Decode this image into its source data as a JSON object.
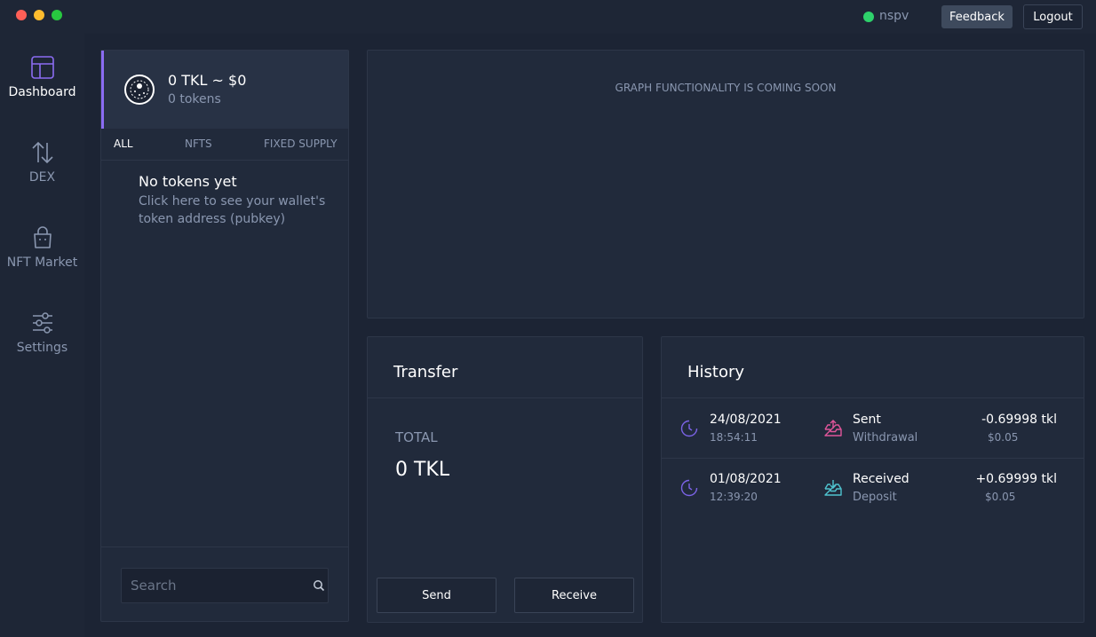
{
  "window": {
    "controls": [
      "close",
      "minimize",
      "maximize"
    ]
  },
  "header": {
    "status_label": "nspv",
    "status_color": "#2ed16b",
    "feedback_label": "Feedback",
    "logout_label": "Logout"
  },
  "nav": {
    "items": [
      {
        "label": "Dashboard",
        "icon": "dashboard-icon",
        "active": true
      },
      {
        "label": "DEX",
        "icon": "swap-arrows-icon",
        "active": false
      },
      {
        "label": "NFT Market",
        "icon": "shopping-bag-icon",
        "active": false
      },
      {
        "label": "Settings",
        "icon": "sliders-icon",
        "active": false
      }
    ]
  },
  "tokens": {
    "summary_value": "0 TKL ~ $0",
    "summary_count": "0 tokens",
    "tabs": [
      "ALL",
      "NFTS",
      "FIXED SUPPLY"
    ],
    "active_tab": "ALL",
    "empty_title": "No tokens yet",
    "empty_desc": "Click here to see your wallet's token address (pubkey)",
    "search_placeholder": "Search"
  },
  "graph": {
    "message": "GRAPH FUNCTIONALITY IS COMING SOON"
  },
  "transfer": {
    "title": "Transfer",
    "total_label": "TOTAL",
    "total_value": "0 TKL",
    "send_label": "Send",
    "receive_label": "Receive"
  },
  "history": {
    "title": "History",
    "rows": [
      {
        "date": "24/08/2021",
        "time": "18:54:11",
        "type": "Sent",
        "subtype": "Withdrawal",
        "amount": "-0.69998 tkl",
        "usd": "$0.05",
        "icon": "outbox-icon",
        "icon_color": "#e0559a"
      },
      {
        "date": "01/08/2021",
        "time": "12:39:20",
        "type": "Received",
        "subtype": "Deposit",
        "amount": "+0.69999 tkl",
        "usd": "$0.05",
        "icon": "inbox-icon",
        "icon_color": "#4fc3cf"
      }
    ]
  },
  "colors": {
    "accent": "#8b6cf2",
    "background": "#1c2434",
    "panel": "#212a3b"
  }
}
